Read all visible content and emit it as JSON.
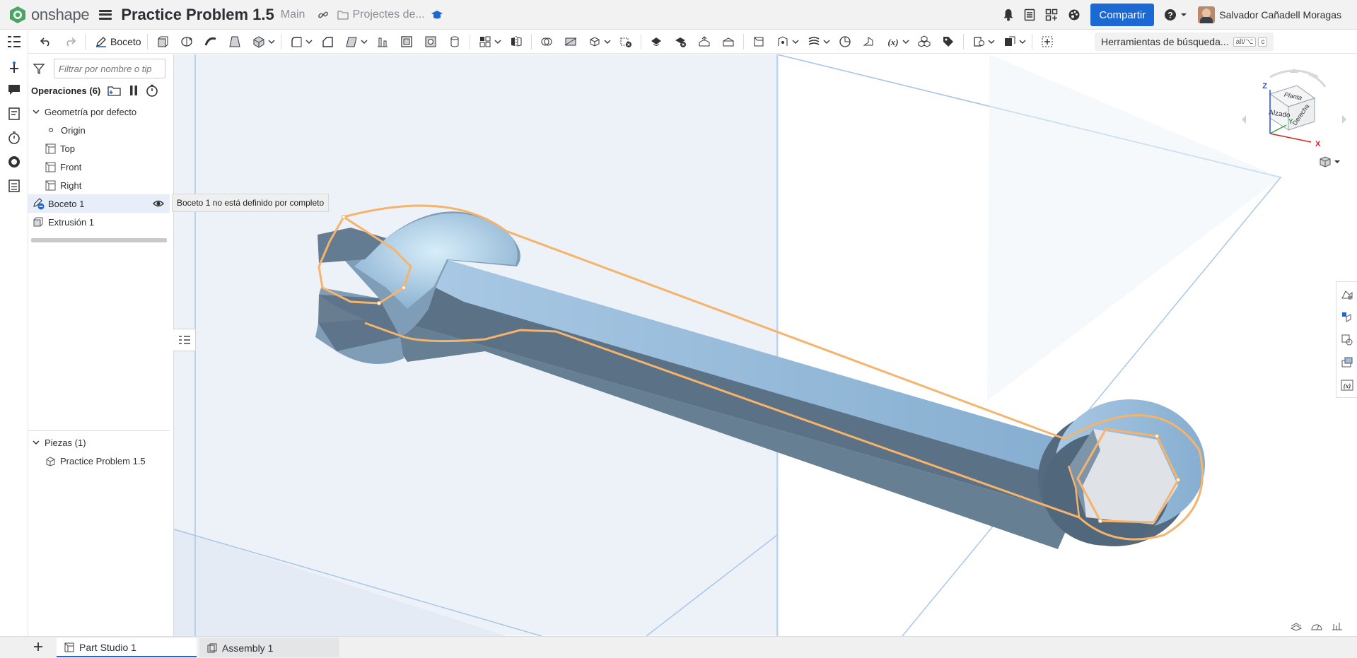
{
  "app": {
    "name": "onshape"
  },
  "document": {
    "title": "Practice Problem 1.5",
    "branch": "Main",
    "folder": "Projectes de..."
  },
  "header": {
    "share_label": "Compartir",
    "user_name": "Salvador Cañadell Moragas"
  },
  "toolbar": {
    "sketch_label": "Boceto",
    "search_tools_label": "Herramientas de búsqueda...",
    "search_shortcut": "alt/⌥",
    "search_shortcut_key": "c"
  },
  "feature_panel": {
    "filter_placeholder": "Filtrar por nombre o tip",
    "operations_label": "Operaciones (6)",
    "default_geometry_label": "Geometría por defecto",
    "default_items": [
      "Origin",
      "Top",
      "Front",
      "Right"
    ],
    "features": [
      {
        "label": "Boceto 1",
        "selected": true
      },
      {
        "label": "Extrusión 1",
        "selected": false
      }
    ],
    "tooltip": "Boceto 1 no está definido por completo",
    "parts_label": "Piezas (1)",
    "parts": [
      "Practice Problem 1.5"
    ]
  },
  "view_cube": {
    "face_top": "Planta",
    "face_front": "Alzado",
    "face_right": "Derecha",
    "axis_z": "Z",
    "axis_x": "X",
    "axis_y": "Y"
  },
  "tabs": [
    {
      "label": "Part Studio 1",
      "active": true
    },
    {
      "label": "Assembly 1",
      "active": false
    }
  ],
  "colors": {
    "accent": "#1c69d4",
    "sketch_orange": "#f5b36b",
    "part_blue": "#8fb4d3",
    "plane_fill": "#e8eef6",
    "plane_edge": "#a9c7e8"
  }
}
